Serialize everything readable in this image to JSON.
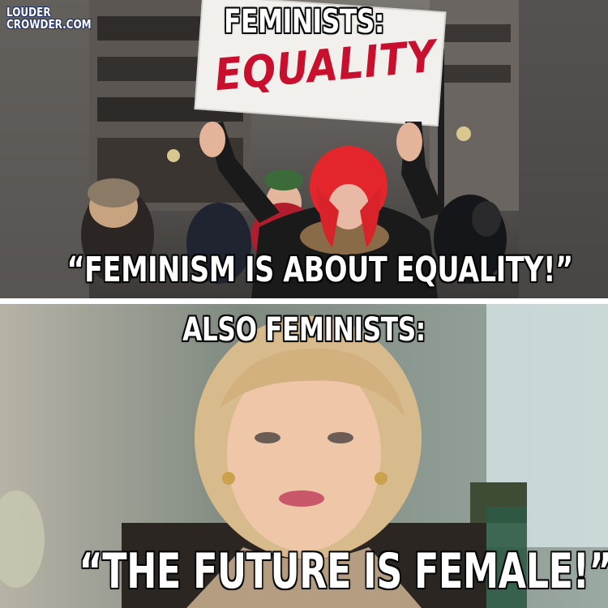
{
  "logo": {
    "line1": "LOUDER",
    "line2": "CROWDER.COM"
  },
  "top_panel": {
    "heading": "FEMINISTS:",
    "sign_text": "EQUALITY",
    "quote": "“FEMINISM IS ABOUT EQUALITY!”"
  },
  "bottom_panel": {
    "heading": "ALSO FEMINISTS:",
    "quote": "“THE FUTURE IS FEMALE!”"
  },
  "colors": {
    "caption_text": "#ffffff",
    "caption_outline": "#000000",
    "divider": "#ffffff",
    "sign_lettering": "#c8102e",
    "hair_red": "#e3262b"
  }
}
